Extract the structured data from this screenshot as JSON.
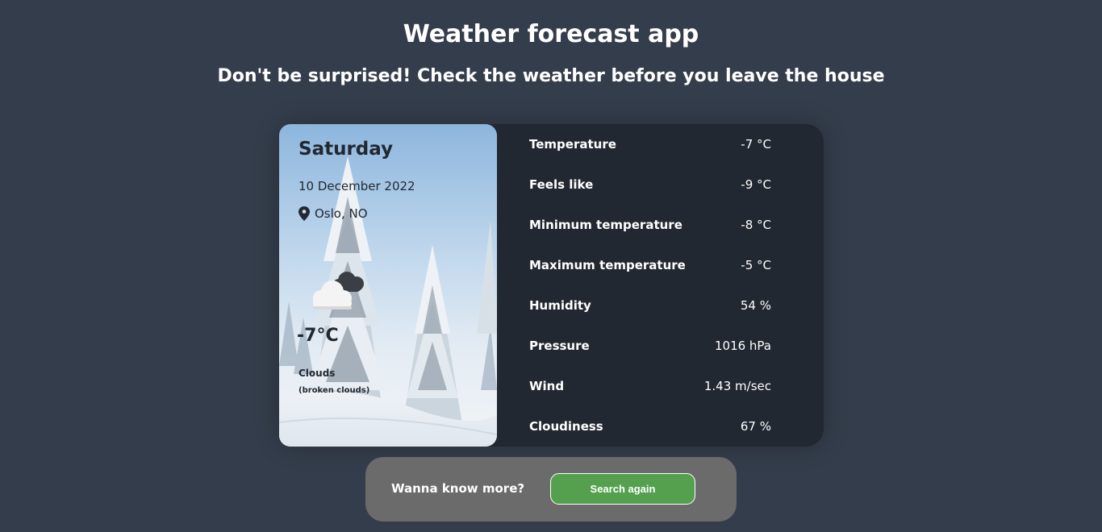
{
  "header": {
    "title": "Weather forecast app",
    "subtitle": "Don't be surprised! Check the weather before you leave the house"
  },
  "current": {
    "day": "Saturday",
    "date": "10 December 2022",
    "location": "Oslo, NO",
    "location_icon": "map-pin-icon",
    "weather_icon": "broken-clouds-icon",
    "temperature": "-7°C",
    "description": "Clouds",
    "description_detail": "(broken clouds)"
  },
  "details": [
    {
      "label": "Temperature",
      "value": "-7 °C"
    },
    {
      "label": "Feels like",
      "value": "-9 °C"
    },
    {
      "label": "Minimum temperature",
      "value": "-8 °C"
    },
    {
      "label": "Maximum temperature",
      "value": "-5 °C"
    },
    {
      "label": "Humidity",
      "value": "54 %"
    },
    {
      "label": "Pressure",
      "value": "1016 hPa"
    },
    {
      "label": "Wind",
      "value": "1.43 m/sec"
    },
    {
      "label": "Cloudiness",
      "value": "67 %"
    }
  ],
  "more": {
    "text": "Wanna know more?",
    "button_label": "Search again"
  },
  "colors": {
    "background": "#343d4b",
    "card": "#222831",
    "more_box": "#6b6b6b",
    "button": "#55a04f"
  }
}
